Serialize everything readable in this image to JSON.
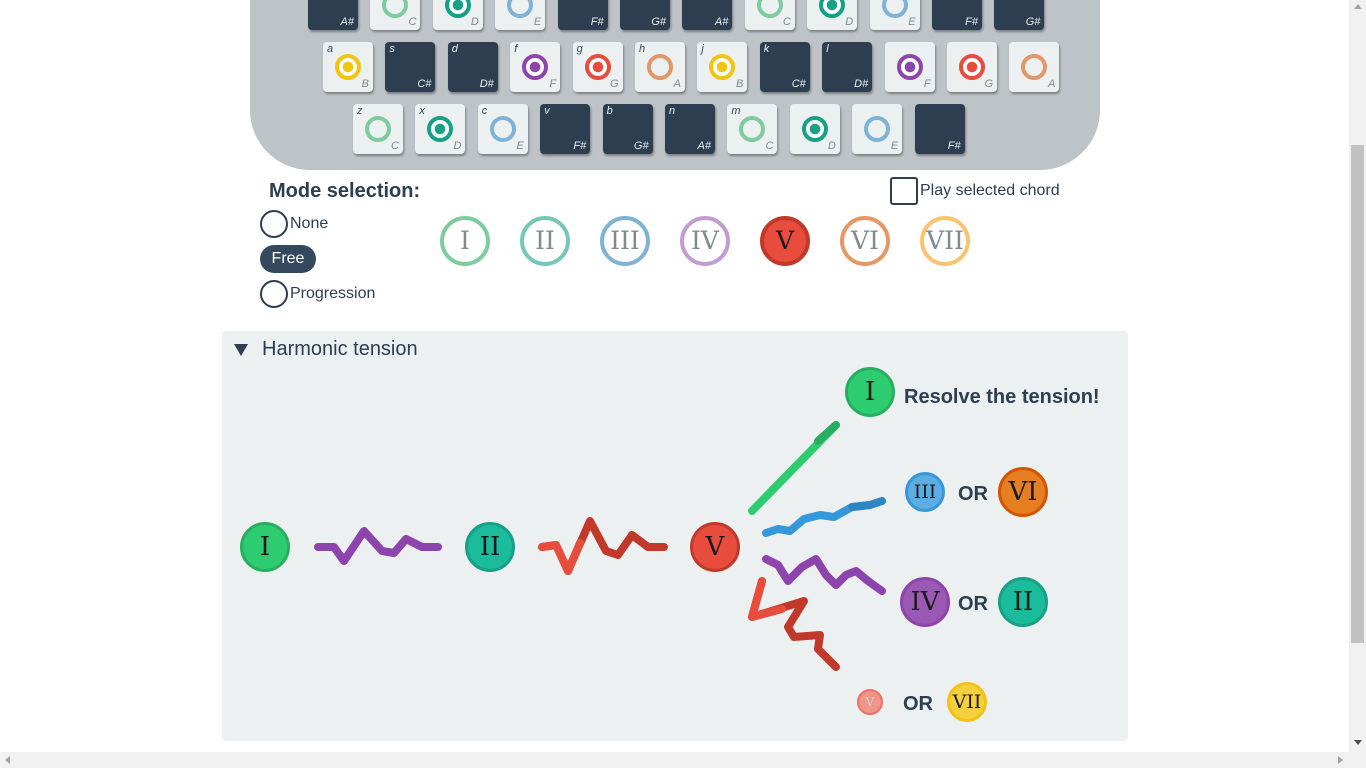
{
  "keyboard": {
    "rows": [
      [
        {
          "key": "",
          "note": "A#",
          "type": "black",
          "ring": null
        },
        {
          "key": "",
          "note": "C",
          "type": "white",
          "ring": "#7fcba0"
        },
        {
          "key": "",
          "note": "D",
          "type": "white",
          "ring": "#16a085",
          "dot": true
        },
        {
          "key": "",
          "note": "E",
          "type": "white",
          "ring": "#7fb3d5"
        },
        {
          "key": "",
          "note": "F#",
          "type": "black",
          "ring": null
        },
        {
          "key": "",
          "note": "G#",
          "type": "black",
          "ring": null
        },
        {
          "key": "",
          "note": "A#",
          "type": "black",
          "ring": null
        },
        {
          "key": "",
          "note": "C",
          "type": "white",
          "ring": "#7fcba0"
        },
        {
          "key": "",
          "note": "D",
          "type": "white",
          "ring": "#16a085",
          "dot": true
        },
        {
          "key": "",
          "note": "E",
          "type": "white",
          "ring": "#7fb3d5"
        },
        {
          "key": "",
          "note": "F#",
          "type": "black",
          "ring": null
        },
        {
          "key": "",
          "note": "G#",
          "type": "black",
          "ring": null
        }
      ],
      [
        {
          "key": "a",
          "note": "B",
          "type": "white",
          "ring": "#f1c40f",
          "dot": true
        },
        {
          "key": "s",
          "note": "C#",
          "type": "black",
          "ring": null
        },
        {
          "key": "d",
          "note": "D#",
          "type": "black",
          "ring": null
        },
        {
          "key": "f",
          "note": "F",
          "type": "white",
          "ring": "#8e44ad",
          "dot": true
        },
        {
          "key": "g",
          "note": "G",
          "type": "white",
          "ring": "#e74c3c",
          "dot": true
        },
        {
          "key": "h",
          "note": "A",
          "type": "white",
          "ring": "#e0986a"
        },
        {
          "key": "j",
          "note": "B",
          "type": "white",
          "ring": "#f1c40f",
          "dot": true
        },
        {
          "key": "k",
          "note": "C#",
          "type": "black",
          "ring": null
        },
        {
          "key": "l",
          "note": "D#",
          "type": "black",
          "ring": null
        },
        {
          "key": "",
          "note": "F",
          "type": "white",
          "ring": "#8e44ad",
          "dot": true
        },
        {
          "key": "",
          "note": "G",
          "type": "white",
          "ring": "#e74c3c",
          "dot": true
        },
        {
          "key": "",
          "note": "A",
          "type": "white",
          "ring": "#e0986a"
        }
      ],
      [
        {
          "key": "z",
          "note": "C",
          "type": "white",
          "ring": "#7fcba0"
        },
        {
          "key": "x",
          "note": "D",
          "type": "white",
          "ring": "#16a085",
          "dot": true
        },
        {
          "key": "c",
          "note": "E",
          "type": "white",
          "ring": "#7fb3d5"
        },
        {
          "key": "v",
          "note": "F#",
          "type": "black",
          "ring": null
        },
        {
          "key": "b",
          "note": "G#",
          "type": "black",
          "ring": null
        },
        {
          "key": "n",
          "note": "A#",
          "type": "black",
          "ring": null
        },
        {
          "key": "m",
          "note": "C",
          "type": "white",
          "ring": "#7fcba0"
        },
        {
          "key": "",
          "note": "D",
          "type": "white",
          "ring": "#16a085",
          "dot": true
        },
        {
          "key": "",
          "note": "E",
          "type": "white",
          "ring": "#7fb3d5"
        },
        {
          "key": "",
          "note": "F#",
          "type": "black",
          "ring": null
        }
      ]
    ]
  },
  "mode": {
    "title": "Mode selection:",
    "none_label": "None",
    "free_label": "Free",
    "progression_label": "Progression",
    "play_selected_label": "Play selected chord"
  },
  "chords": [
    {
      "label": "I",
      "color": "#7fcba0",
      "selected": false
    },
    {
      "label": "II",
      "color": "#76c7b7",
      "selected": false
    },
    {
      "label": "III",
      "color": "#7fb3d5",
      "selected": false
    },
    {
      "label": "IV",
      "color": "#c39bd3",
      "selected": false
    },
    {
      "label": "V",
      "color": "#e74c3c",
      "selected": true
    },
    {
      "label": "VI",
      "color": "#e59866",
      "selected": false
    },
    {
      "label": "VII",
      "color": "#f8c471",
      "selected": false
    }
  ],
  "tension": {
    "title": "Harmonic tension",
    "resolve_text": "Resolve the tension!",
    "or_text": "OR",
    "chain": [
      "I",
      "II",
      "V"
    ],
    "resolutions": {
      "top": "I",
      "row1": [
        "III",
        "VI"
      ],
      "row2": [
        "IV",
        "II"
      ],
      "row3": [
        "V",
        "VII"
      ]
    }
  },
  "icons": {
    "collapse": "triangle-down-icon",
    "scroll_up": "arrow-up-icon",
    "scroll_down": "arrow-down-icon",
    "scroll_left": "arrow-left-icon",
    "scroll_right": "arrow-right-icon"
  }
}
